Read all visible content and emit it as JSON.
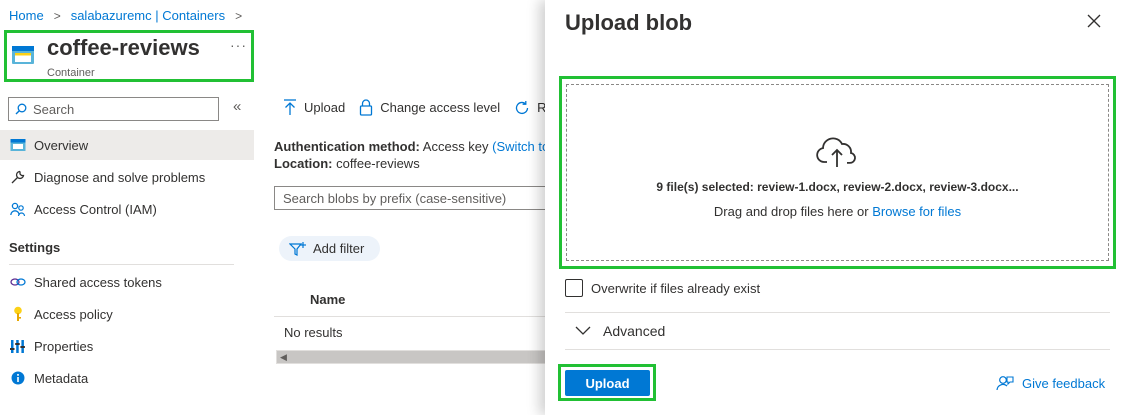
{
  "breadcrumb": {
    "home": "Home",
    "parent": "salabazuremc | Containers"
  },
  "header": {
    "title": "coffee-reviews",
    "subtitle": "Container",
    "more": "···"
  },
  "sidebar": {
    "search_placeholder": "Search",
    "collapse": "«",
    "items": [
      {
        "label": "Overview",
        "icon": "container-icon"
      },
      {
        "label": "Diagnose and solve problems",
        "icon": "wrench-icon"
      },
      {
        "label": "Access Control (IAM)",
        "icon": "people-icon"
      }
    ],
    "settings_title": "Settings",
    "settings_items": [
      {
        "label": "Shared access tokens",
        "icon": "link-icon"
      },
      {
        "label": "Access policy",
        "icon": "key-icon"
      },
      {
        "label": "Properties",
        "icon": "properties-icon"
      },
      {
        "label": "Metadata",
        "icon": "info-icon"
      }
    ]
  },
  "toolbar": {
    "upload": "Upload",
    "change_access": "Change access level",
    "refresh": "R"
  },
  "info": {
    "auth_label": "Authentication method:",
    "auth_value": "Access key",
    "auth_link": "(Switch to",
    "location_label": "Location:",
    "location_value": "coffee-reviews"
  },
  "blob_search": {
    "placeholder": "Search blobs by prefix (case-sensitive)"
  },
  "filter": {
    "add_label": "Add filter"
  },
  "table": {
    "column_name": "Name",
    "empty": "No results"
  },
  "panel": {
    "title": "Upload blob",
    "selected_files": "9 file(s) selected: review-1.docx, review-2.docx, review-3.docx...",
    "drag_text": "Drag and drop files here  or",
    "browse_link": "Browse for files",
    "overwrite_label": "Overwrite if files already exist",
    "advanced_label": "Advanced",
    "upload_button": "Upload",
    "feedback_link": "Give feedback"
  },
  "colors": {
    "accent": "#0078d4",
    "highlight": "#21c034",
    "selected_bg": "#edebe9"
  }
}
